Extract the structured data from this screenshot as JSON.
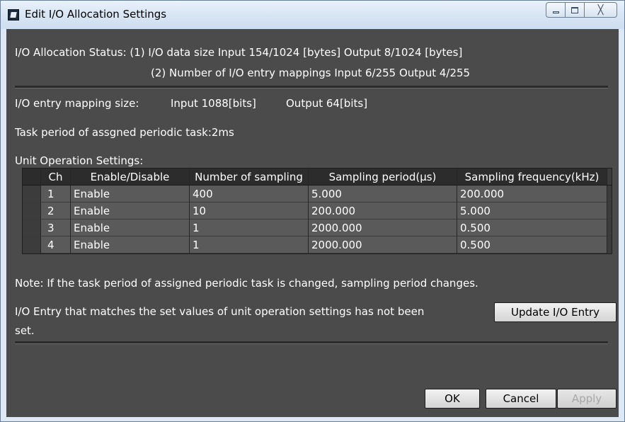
{
  "window": {
    "title": "Edit I/O Allocation Settings"
  },
  "status": {
    "line1": "I/O Allocation Status: (1) I/O data size Input 154/1024 [bytes] Output 8/1024 [bytes]",
    "line2": "(2) Number of I/O entry mappings Input 6/255 Output 4/255"
  },
  "mapping_size": {
    "label": "I/O entry mapping size:",
    "input": "Input 1088[bits]",
    "output": "Output 64[bits]"
  },
  "task_period": "Task period of assgned periodic task:2ms",
  "unit_settings": {
    "label": "Unit Operation Settings:",
    "columns": [
      "Ch",
      "Enable/Disable",
      "Number of sampling",
      "Sampling period(µs)",
      "Sampling frequency(kHz)"
    ],
    "rows": [
      [
        "1",
        "Enable",
        "400",
        "5.000",
        "200.000"
      ],
      [
        "2",
        "Enable",
        "10",
        "200.000",
        "5.000"
      ],
      [
        "3",
        "Enable",
        "1",
        "2000.000",
        "0.500"
      ],
      [
        "4",
        "Enable",
        "1",
        "2000.000",
        "0.500"
      ]
    ]
  },
  "note": "Note: If the task period of assigned periodic task is changed, sampling period changes.",
  "entry_msg": {
    "line1": "I/O Entry that matches the set values of unit operation settings has not been",
    "line2": "set."
  },
  "buttons": {
    "update": "Update I/O Entry",
    "ok": "OK",
    "cancel": "Cancel",
    "apply": "Apply"
  },
  "window_controls": {
    "close_glyph": "╳"
  }
}
